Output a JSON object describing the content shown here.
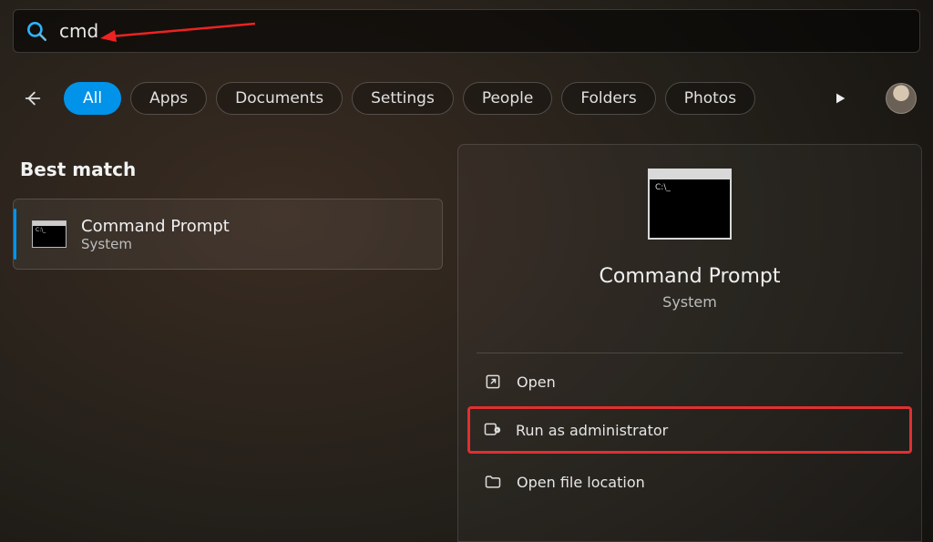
{
  "search": {
    "query": "cmd"
  },
  "filters": {
    "items": [
      "All",
      "Apps",
      "Documents",
      "Settings",
      "People",
      "Folders",
      "Photos"
    ],
    "active_index": 0
  },
  "section_heading": "Best match",
  "result": {
    "title": "Command Prompt",
    "subtitle": "System"
  },
  "details": {
    "title": "Command Prompt",
    "subtitle": "System",
    "actions": [
      {
        "icon": "open-icon",
        "label": "Open"
      },
      {
        "icon": "admin-icon",
        "label": "Run as administrator",
        "highlight": true
      },
      {
        "icon": "folder-icon",
        "label": "Open file location"
      }
    ]
  }
}
